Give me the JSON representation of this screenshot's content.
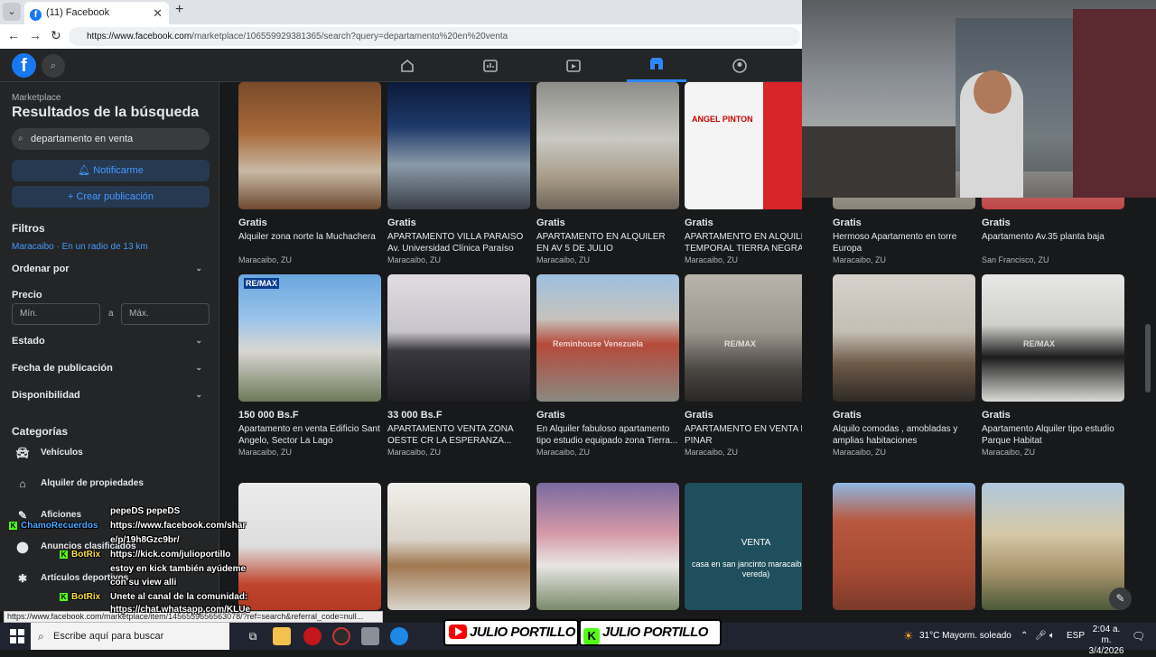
{
  "browser": {
    "tab_title": "(11) Facebook",
    "url_prefix": "https://www.facebook.com",
    "url_rest": "/marketplace/106559929381365/search?query=departamento%20en%20venta"
  },
  "sidebar": {
    "section_label": "Marketplace",
    "title": "Resultados de la búsqueda",
    "search_value": "departamento en venta",
    "notify_label": "Notificarme",
    "create_label": "Crear publicación",
    "filters_heading": "Filtros",
    "location_text": "Maracaibo · En un radio de 13 km",
    "sort_label": "Ordenar por",
    "price_label": "Precio",
    "price_min_placeholder": "Mín.",
    "price_sep": "a",
    "price_max_placeholder": "Máx.",
    "state_label": "Estado",
    "date_label": "Fecha de publicación",
    "availability_label": "Disponibilidad",
    "categories_heading": "Categorías",
    "categories": [
      "Vehículos",
      "Alquiler de propiedades",
      "Aficiones",
      "Anuncios clasificados",
      "Artículos deportivos"
    ]
  },
  "listings": [
    {
      "price": "Gratis",
      "title": "Alquiler zona norte la Muchachera",
      "location": "Maracaibo, ZU"
    },
    {
      "price": "Gratis",
      "title": "APARTAMENTO VILLA PARAISO Av. Universidad Clínica Paraíso",
      "location": "Maracaibo, ZU"
    },
    {
      "price": "Gratis",
      "title": "APARTAMENTO EN ALQUILER EN AV 5 DE JULIO",
      "location": "Maracaibo, ZU"
    },
    {
      "price": "Gratis",
      "title": "APARTAMENTO EN ALQUILER TEMPORAL TIERRA NEGRA...",
      "location": "Maracaibo, ZU"
    },
    {
      "price": "Gratis",
      "title": "Hermoso Apartamento en torre Europa",
      "location": "Maracaibo, ZU"
    },
    {
      "price": "Gratis",
      "title": "Apartamento Av.35 planta baja",
      "location": "San Francisco, ZU"
    },
    {
      "price": "150 000 Bs.F",
      "title": "Apartamento en venta Edificio Sant Angelo, Sector La Lago",
      "location": "Maracaibo, ZU"
    },
    {
      "price": "33 000 Bs.F",
      "title": "APARTAMENTO VENTA ZONA OESTE CR LA ESPERANZA...",
      "location": "Maracaibo, ZU"
    },
    {
      "price": "Gratis",
      "title": "En Alquiler fabuloso apartamento tipo estudio equipado zona Tierra...",
      "location": "Maracaibo, ZU"
    },
    {
      "price": "Gratis",
      "title": "APARTAMENTO EN VENTA EN EL PINAR",
      "location": "Maracaibo, ZU"
    },
    {
      "price": "Gratis",
      "title": "Alquilo comodas , amobladas y amplias habitaciones",
      "location": "Maracaibo, ZU"
    },
    {
      "price": "Gratis",
      "title": "Apartamento Alquiler tipo estudio Parque Habitat",
      "location": "Maracaibo, ZU"
    }
  ],
  "image_overlays": {
    "angel_pinton": "ANGEL PINTON",
    "remax": "RE/MAX",
    "reminhouse": "Reminhouse Venezuela",
    "venta": "VENTA",
    "casa_text": "casa en san jancinto maracaibo (en vereda)"
  },
  "status_url": "https://www.facebook.com/marketplace/item/1456559656563078/?ref=search&referral_code=null...",
  "chat": {
    "l1": "pepeDS pepeDS",
    "l2_user": "ChamoRecuerdos",
    "l2": "https://www.facebook.com/shar",
    "l3": "e/p/19h8Gzc9br/",
    "l4_user": "BotRix",
    "l4": "https://kick.com/julioportillo",
    "l5": "estoy en kick también ayúdeme",
    "l6": "con su view alli",
    "l7_user": "BotRix",
    "l7": "Unete al canal de la comunidad:",
    "l8": "https://chat.whatsapp.com/KLUe"
  },
  "banner": {
    "left": "JULIO PORTILLO",
    "right": "JULIO PORTILLO"
  },
  "taskbar": {
    "search_placeholder": "Escribe aquí para buscar",
    "weather": "31°C  Mayorm. soleado",
    "lang": "ESP",
    "time": "2:04 a. m.",
    "date": "3/4/2026"
  },
  "colors": {
    "fb_blue": "#1877f2",
    "link_blue": "#4599ff",
    "kick_green": "#53fc18"
  }
}
